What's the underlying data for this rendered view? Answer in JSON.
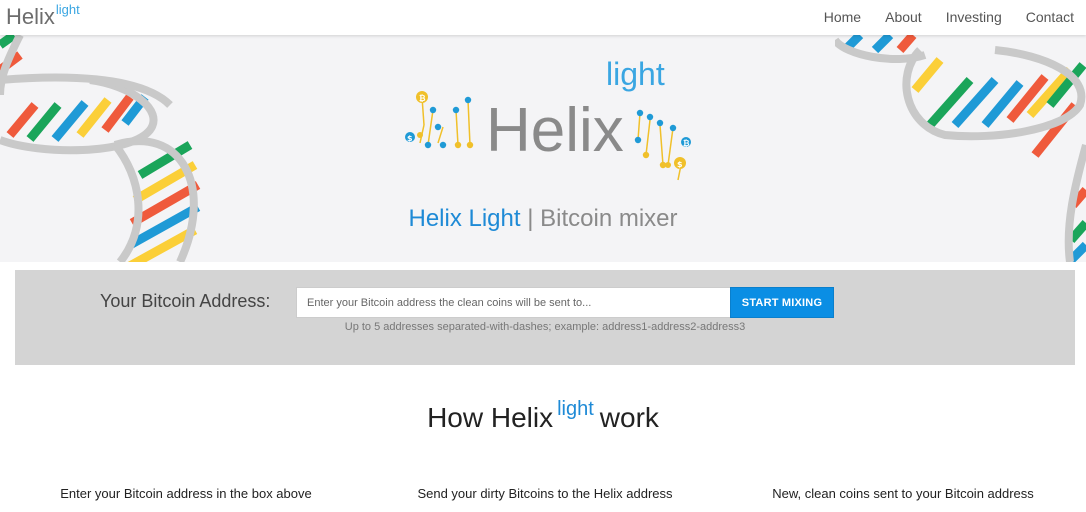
{
  "navbar": {
    "brand": "Helix",
    "brand_sup": "light",
    "links": [
      "Home",
      "About",
      "Investing",
      "Contact"
    ]
  },
  "hero": {
    "logo_word": "Helix",
    "logo_sup": "light",
    "title_blue": "Helix Light",
    "title_separator": " | ",
    "title_gray": "Bitcoin mixer"
  },
  "form": {
    "label": "Your Bitcoin Address:",
    "placeholder": "Enter your Bitcoin address the clean coins will be sent to...",
    "button": "START MIXING",
    "hint": "Up to 5 addresses separated-with-dashes; example: address1-address2-address3"
  },
  "how": {
    "prefix": "How Helix",
    "sup": "light",
    "suffix": "work",
    "steps": [
      "Enter your Bitcoin address in the box above",
      "Send your dirty Bitcoins to the Helix address",
      "New, clean coins sent to your Bitcoin address"
    ]
  },
  "colors": {
    "accent_blue": "#1e8ad6",
    "button_blue": "#0a8ee4",
    "panel_gray": "#d4d4d4",
    "hero_bg": "#f4f4f6",
    "dna_stripes": [
      "#ef5a3c",
      "#fbcf38",
      "#1f9ad6",
      "#1aa55a"
    ]
  },
  "icons": [
    "bitcoin-icon",
    "dollar-icon",
    "dna-helix-decoration"
  ]
}
